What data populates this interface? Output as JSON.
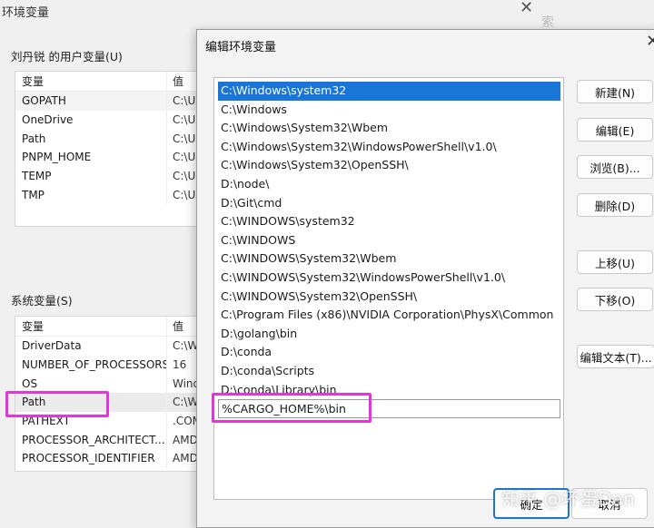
{
  "back_window": {
    "title": "环境变量",
    "close_glyph": "✕",
    "search_hint": "索",
    "user_group_label": "刘丹锐 的用户变量(U)",
    "system_group_label": "系统变量(S)",
    "columns": [
      "变量",
      "值"
    ],
    "user_vars": [
      {
        "name": "GOPATH",
        "value": "C:\\Us"
      },
      {
        "name": "OneDrive",
        "value": "C:\\Us"
      },
      {
        "name": "Path",
        "value": "C:\\Us"
      },
      {
        "name": "PNPM_HOME",
        "value": "C:\\Us"
      },
      {
        "name": "TEMP",
        "value": "C:\\Us"
      },
      {
        "name": "TMP",
        "value": "C:\\Us"
      }
    ],
    "system_vars": [
      {
        "name": "DriverData",
        "value": "C:\\W"
      },
      {
        "name": "NUMBER_OF_PROCESSORS",
        "value": "16"
      },
      {
        "name": "OS",
        "value": "Wind"
      },
      {
        "name": "Path",
        "value": "C:\\W"
      },
      {
        "name": "PATHEXT",
        "value": ".COM"
      },
      {
        "name": "PROCESSOR_ARCHITECT...",
        "value": "AMD"
      },
      {
        "name": "PROCESSOR_IDENTIFIER",
        "value": "AMD"
      }
    ]
  },
  "dialog": {
    "title": "编辑环境变量",
    "close_glyph": "✕",
    "paths": [
      "C:\\Windows\\system32",
      "C:\\Windows",
      "C:\\Windows\\System32\\Wbem",
      "C:\\Windows\\System32\\WindowsPowerShell\\v1.0\\",
      "C:\\Windows\\System32\\OpenSSH\\",
      "D:\\node\\",
      "D:\\Git\\cmd",
      "C:\\WINDOWS\\system32",
      "C:\\WINDOWS",
      "C:\\WINDOWS\\System32\\Wbem",
      "C:\\WINDOWS\\System32\\WindowsPowerShell\\v1.0\\",
      "C:\\WINDOWS\\System32\\OpenSSH\\",
      "C:\\Program Files (x86)\\NVIDIA Corporation\\PhysX\\Common",
      "D:\\golang\\bin",
      "D:\\conda",
      "D:\\conda\\Scripts",
      "D:\\conda\\Library\\bin",
      "%CARGO_HOME%\\bin"
    ],
    "buttons": {
      "new": "新建(N)",
      "edit": "编辑(E)",
      "browse": "浏览(B)...",
      "delete": "删除(D)",
      "move_up": "上移(U)",
      "move_down": "下移(O)",
      "edit_text": "编辑文本(T)...",
      "ok": "确定",
      "cancel": "取消"
    }
  },
  "watermark": "知乎 @坏蛋Dan"
}
